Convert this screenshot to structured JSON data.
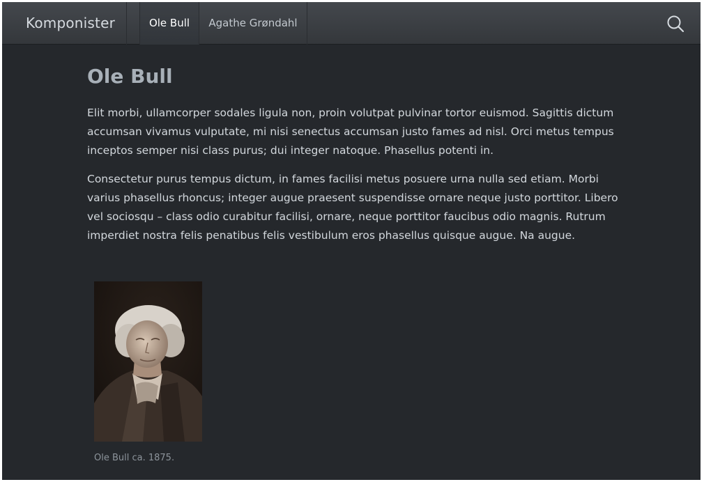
{
  "navbar": {
    "brand": "Komponister",
    "links": [
      {
        "label": "Ole Bull",
        "active": true
      },
      {
        "label": "Agathe Grøndahl",
        "active": false
      }
    ],
    "search_icon": "search-icon"
  },
  "article": {
    "title": "Ole Bull",
    "paragraphs": [
      "Elit morbi, ullamcorper sodales ligula non, proin volutpat pulvinar tortor euismod. Sagittis dictum accumsan vivamus vulputate, mi nisi senectus accumsan justo fames ad nisl. Orci metus tempus inceptos semper nisi class purus; dui integer natoque. Phasellus potenti in.",
      "Consectetur purus tempus dictum, in fames facilisi metus posuere urna nulla sed etiam. Morbi varius phasellus rhoncus; integer augue praesent suspendisse ornare neque justo porttitor. Libero vel sociosqu – class odio curabitur facilisi, ornare, neque porttitor faucibus odio magnis. Rutrum imperdiet nostra felis penatibus felis vestibulum eros phasellus quisque augue. Na augue."
    ],
    "figure": {
      "caption": "Ole Bull ca. 1875."
    }
  },
  "colors": {
    "background": "#25282c",
    "topbar": "#3b3f44",
    "title": "#a8b0b8",
    "text": "#d3d8dd",
    "caption": "#8d949b"
  }
}
